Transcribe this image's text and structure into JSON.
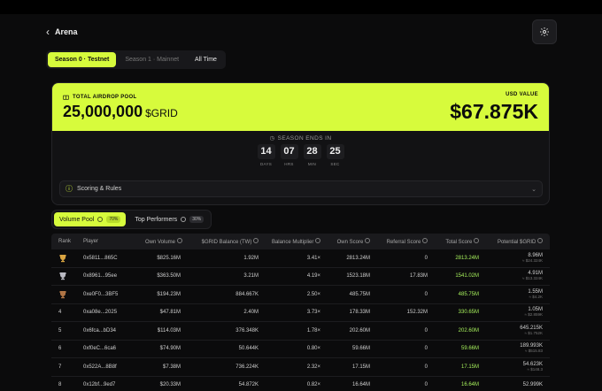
{
  "header": {
    "title": "Arena",
    "back_icon": "chevron-left-icon",
    "settings_icon": "gear-icon"
  },
  "season_tabs": [
    {
      "label": "Season 0 · Testnet",
      "active": true
    },
    {
      "label": "Season 1 · Mainnet",
      "active": false
    },
    {
      "label": "All Time",
      "active": false
    }
  ],
  "pool": {
    "label": "TOTAL AIRDROP POOL",
    "amount": "25,000,000",
    "token": "$GRID",
    "usd_label": "USD VALUE",
    "usd_value": "$67.875K",
    "accent": "#d7fb3c"
  },
  "season_end": {
    "label": "SEASON ENDS IN",
    "countdown": [
      {
        "value": "14",
        "unit": "DAYS"
      },
      {
        "value": "07",
        "unit": "HRS"
      },
      {
        "value": "28",
        "unit": "MIN"
      },
      {
        "value": "25",
        "unit": "SEC"
      }
    ]
  },
  "scoring": {
    "label": "Scoring & Rules"
  },
  "pool_tabs": [
    {
      "label": "Volume Pool",
      "badge": "70%",
      "active": true
    },
    {
      "label": "Top Performers",
      "badge": "30%",
      "active": false
    }
  ],
  "table": {
    "headers": [
      "Rank",
      "Player",
      "Own Volume",
      "$GRID Balance (TW)",
      "Balance Multiplier",
      "Own Score",
      "Referral Score",
      "Total Score",
      "Potential $GRID"
    ],
    "rows": [
      {
        "rank": "",
        "medal": "gold",
        "player": "0x5811...865C",
        "own_volume": "$825.16M",
        "grid_balance": "1.92M",
        "multiplier": "3.41×",
        "own_score": "2813.24M",
        "referral": "0",
        "total": "2813.24M",
        "potential": "8.96M",
        "potential_usd": "≈ $24.324K"
      },
      {
        "rank": "",
        "medal": "silver",
        "player": "0x8961...95ee",
        "own_volume": "$363.50M",
        "grid_balance": "3.21M",
        "multiplier": "4.19×",
        "own_score": "1523.18M",
        "referral": "17.83M",
        "total": "1541.02M",
        "potential": "4.91M",
        "potential_usd": "≈ $13.324K"
      },
      {
        "rank": "",
        "medal": "bronze",
        "player": "0xe0F0...3BF5",
        "own_volume": "$194.23M",
        "grid_balance": "884.667K",
        "multiplier": "2.50×",
        "own_score": "485.75M",
        "referral": "0",
        "total": "485.75M",
        "potential": "1.55M",
        "potential_usd": "≈ $4.2K"
      },
      {
        "rank": "4",
        "medal": "",
        "player": "0xa08e...2025",
        "own_volume": "$47.81M",
        "grid_balance": "2.40M",
        "multiplier": "3.73×",
        "own_score": "178.33M",
        "referral": "152.32M",
        "total": "330.65M",
        "potential": "1.05M",
        "potential_usd": "≈ $2.859K"
      },
      {
        "rank": "5",
        "medal": "",
        "player": "0x6fca...bD34",
        "own_volume": "$114.03M",
        "grid_balance": "376.348K",
        "multiplier": "1.78×",
        "own_score": "202.60M",
        "referral": "0",
        "total": "202.60M",
        "potential": "645.215K",
        "potential_usd": "≈ $1.752K"
      },
      {
        "rank": "6",
        "medal": "",
        "player": "0xf0eC...6ca6",
        "own_volume": "$74.90M",
        "grid_balance": "50.644K",
        "multiplier": "0.80×",
        "own_score": "59.66M",
        "referral": "0",
        "total": "59.66M",
        "potential": "189.993K",
        "potential_usd": "≈ $515.83"
      },
      {
        "rank": "7",
        "medal": "",
        "player": "0x522A...8B8f",
        "own_volume": "$7.38M",
        "grid_balance": "736.224K",
        "multiplier": "2.32×",
        "own_score": "17.15M",
        "referral": "0",
        "total": "17.15M",
        "potential": "54.623K",
        "potential_usd": "≈ $148.3"
      },
      {
        "rank": "8",
        "medal": "",
        "player": "0x12bf...9ed7",
        "own_volume": "$20.33M",
        "grid_balance": "54.872K",
        "multiplier": "0.82×",
        "own_score": "16.64M",
        "referral": "0",
        "total": "16.64M",
        "potential": "52.999K",
        "potential_usd": ""
      }
    ]
  }
}
